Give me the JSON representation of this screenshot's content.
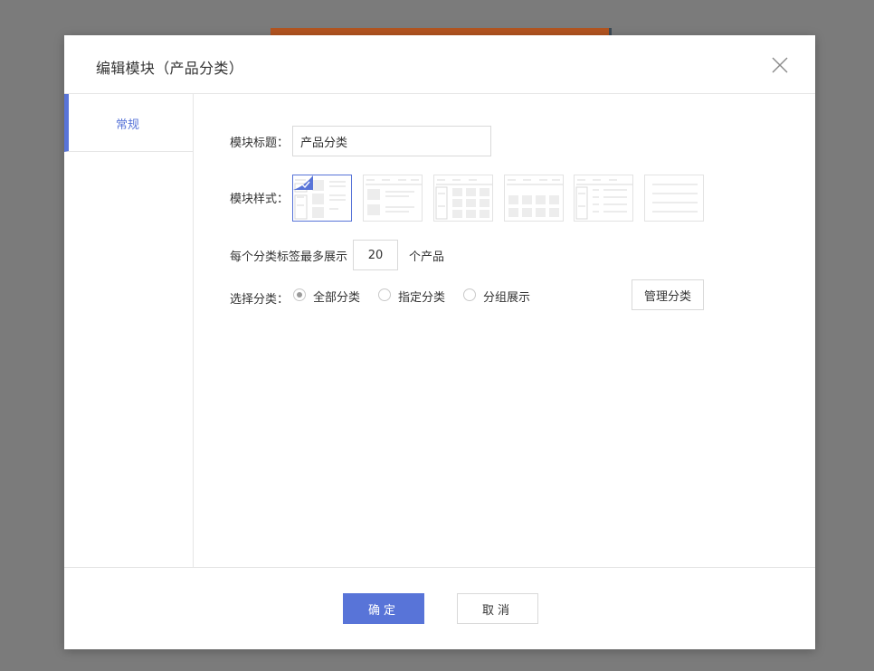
{
  "dialog": {
    "title": "编辑模块（产品分类）",
    "close_icon": "close-icon"
  },
  "sidebar": {
    "tabs": [
      {
        "label": "常规",
        "active": true
      }
    ]
  },
  "form": {
    "module_title_label": "模块标题：",
    "module_title_value": "产品分类",
    "module_style_label": "模块样式：",
    "styles": [
      {
        "name": "left-tabs-grid",
        "selected": true
      },
      {
        "name": "top-tabs-list",
        "selected": false
      },
      {
        "name": "left-tabs-grid-2",
        "selected": false
      },
      {
        "name": "top-tabs-grid",
        "selected": false
      },
      {
        "name": "left-tabs-list",
        "selected": false
      },
      {
        "name": "plain-list",
        "selected": false
      }
    ],
    "per_tab_prefix": "每个分类标签最多展示",
    "per_tab_count": "20",
    "per_tab_suffix": "个产品",
    "select_category_label": "选择分类：",
    "radio_options": [
      {
        "label": "全部分类",
        "checked": true
      },
      {
        "label": "指定分类",
        "checked": false
      },
      {
        "label": "分组展示",
        "checked": false
      }
    ],
    "manage_button": "管理分类"
  },
  "footer": {
    "ok_label": "确定",
    "cancel_label": "取消"
  },
  "colors": {
    "accent": "#5874d8",
    "overlay": "#7b7b7b",
    "border": "#e5e5e5"
  }
}
